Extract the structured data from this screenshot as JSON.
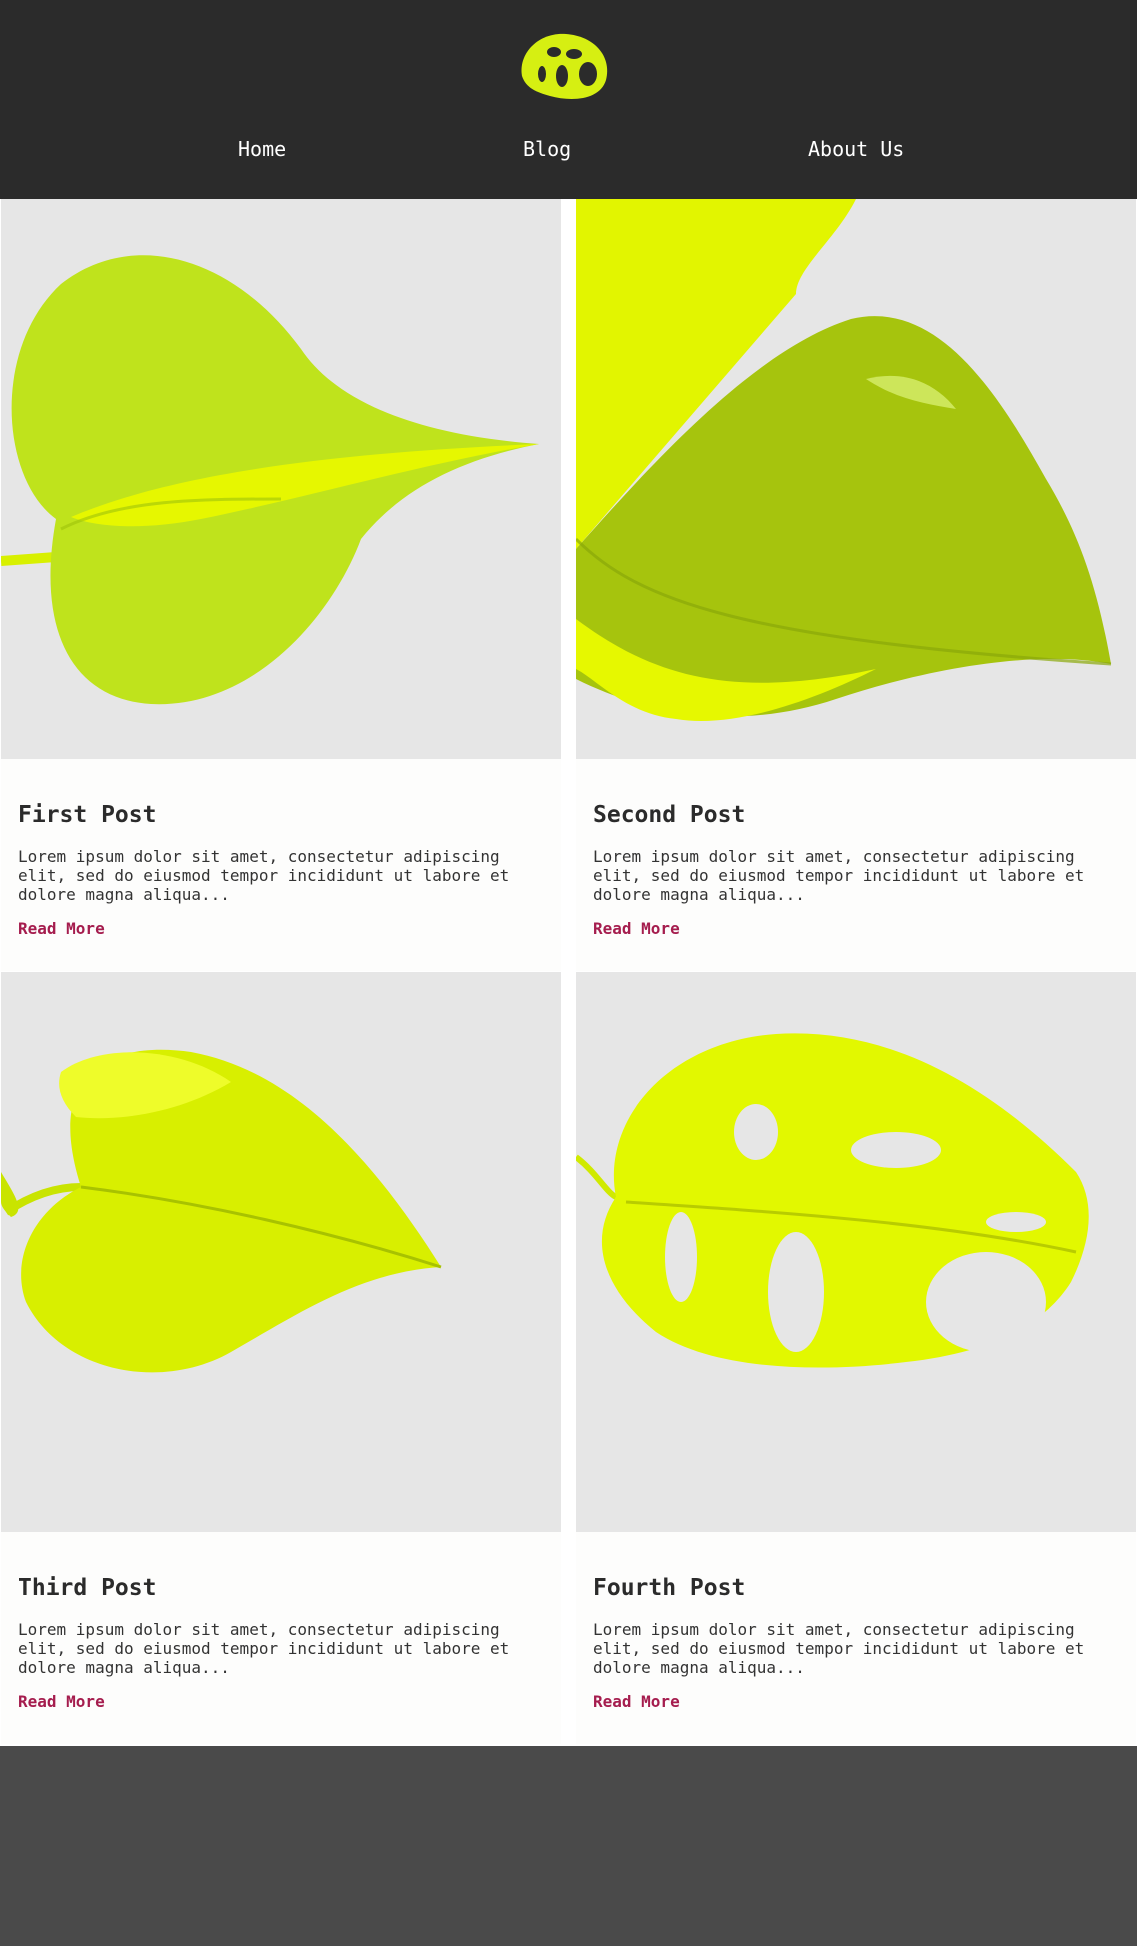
{
  "header": {
    "logo_icon": "monstera-leaf-icon",
    "nav": [
      {
        "label": "Home"
      },
      {
        "label": "Blog"
      },
      {
        "label": "About Us"
      }
    ]
  },
  "posts": [
    {
      "title": "First Post",
      "excerpt": "Lorem ipsum dolor sit amet, consectetur adipiscing elit, sed do eiusmod tempor incididunt ut labore et dolore magna aliqua...",
      "link_label": "Read More",
      "image_icon": "pothos-leaf-image"
    },
    {
      "title": "Second Post",
      "excerpt": "Lorem ipsum dolor sit amet, consectetur adipiscing elit, sed do eiusmod tempor incididunt ut labore et dolore magna aliqua...",
      "link_label": "Read More",
      "image_icon": "variegated-leaf-image"
    },
    {
      "title": "Third Post",
      "excerpt": "Lorem ipsum dolor sit amet, consectetur adipiscing elit, sed do eiusmod tempor incididunt ut labore et dolore magna aliqua...",
      "link_label": "Read More",
      "image_icon": "heart-leaf-image"
    },
    {
      "title": "Fourth Post",
      "excerpt": "Lorem ipsum dolor sit amet, consectetur adipiscing elit, sed do eiusmod tempor incididunt ut labore et dolore magna aliqua...",
      "link_label": "Read More",
      "image_icon": "monstera-leaf-image"
    }
  ],
  "colors": {
    "header_bg": "#2b2b2b",
    "footer_bg": "#4a4a4a",
    "leaf": "#d8f000",
    "image_bg": "#e6e6e6",
    "link": "#a51d4e"
  }
}
